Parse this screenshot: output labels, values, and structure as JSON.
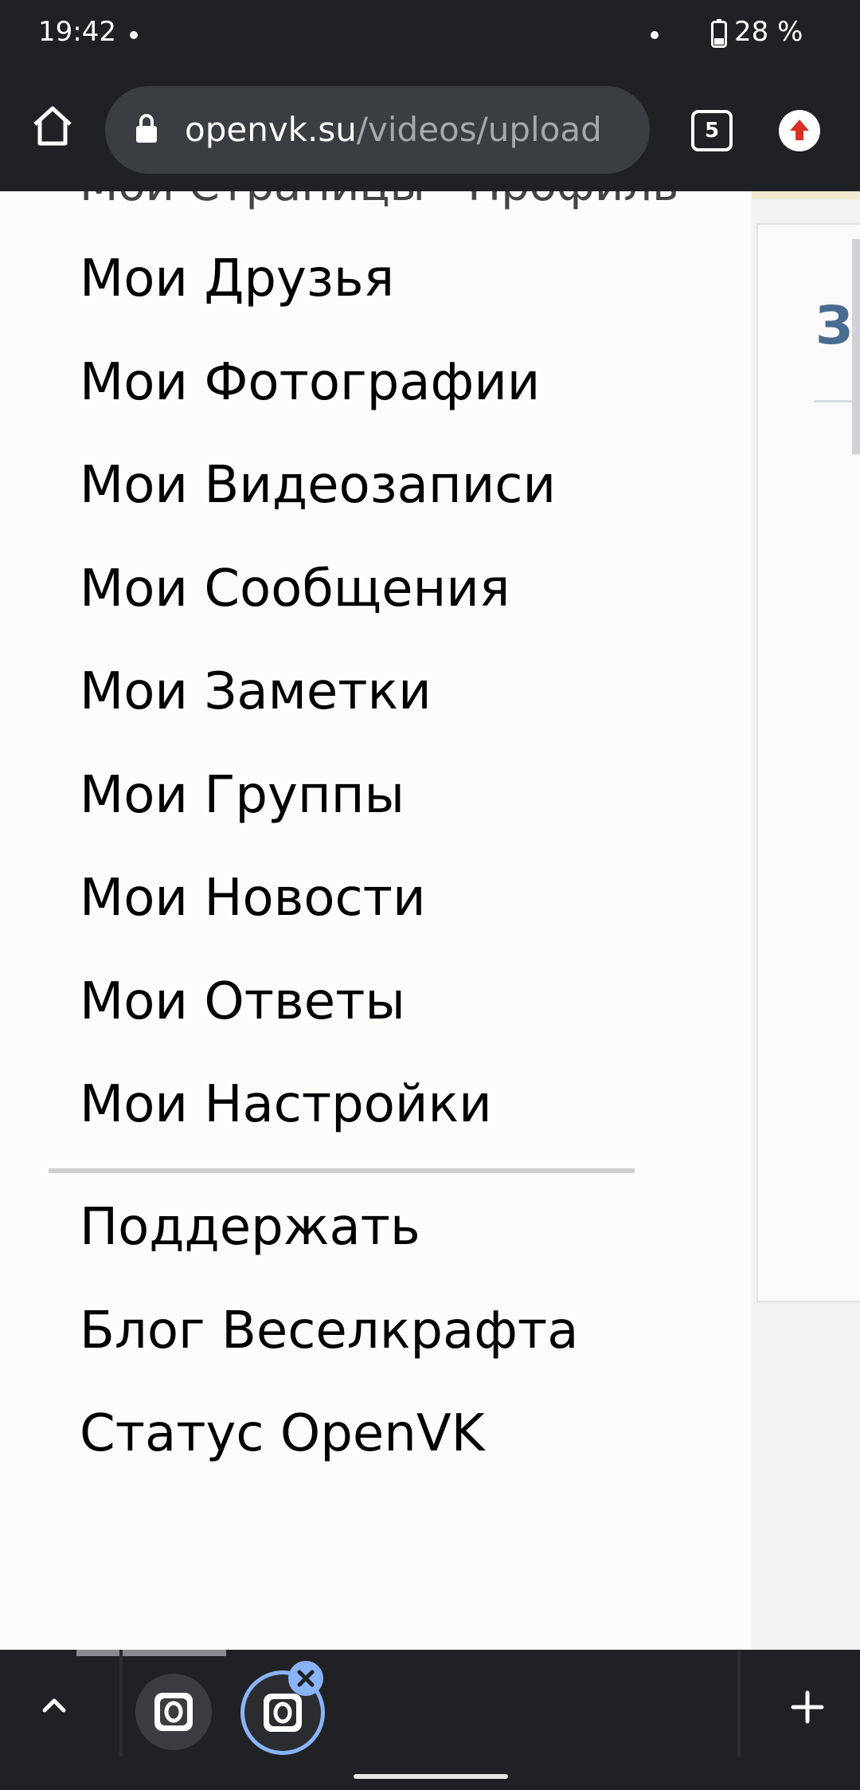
{
  "status_bar": {
    "time": "19:42",
    "battery": "28 %"
  },
  "address_bar": {
    "url_host": "openvk.su",
    "url_path": "/videos/upload",
    "tab_count": "5"
  },
  "drawer": {
    "partial_top_text": "Мои Страницы · Профиль",
    "menu_items": [
      "Мои Друзья",
      "Мои Фотографии",
      "Мои Видеозаписи",
      "Мои Сообщения",
      "Мои Заметки",
      "Мои Группы",
      "Мои Новости",
      "Мои Ответы",
      "Мои Настройки"
    ],
    "extra_items": [
      "Поддержать",
      "Блог Веселкрафта",
      "Статус OpenVK"
    ]
  },
  "page_panel": {
    "title_partial": "За"
  },
  "colors": {
    "accent": "#4a6b91",
    "chrome": "#1f2124",
    "tab_active": "#8ab4f8"
  },
  "icons": {
    "home": "home-icon",
    "lock": "lock-icon",
    "upload": "upload-arrow-icon",
    "chevron_up": "chevron-up-icon",
    "add": "plus-icon",
    "close": "close-icon"
  }
}
